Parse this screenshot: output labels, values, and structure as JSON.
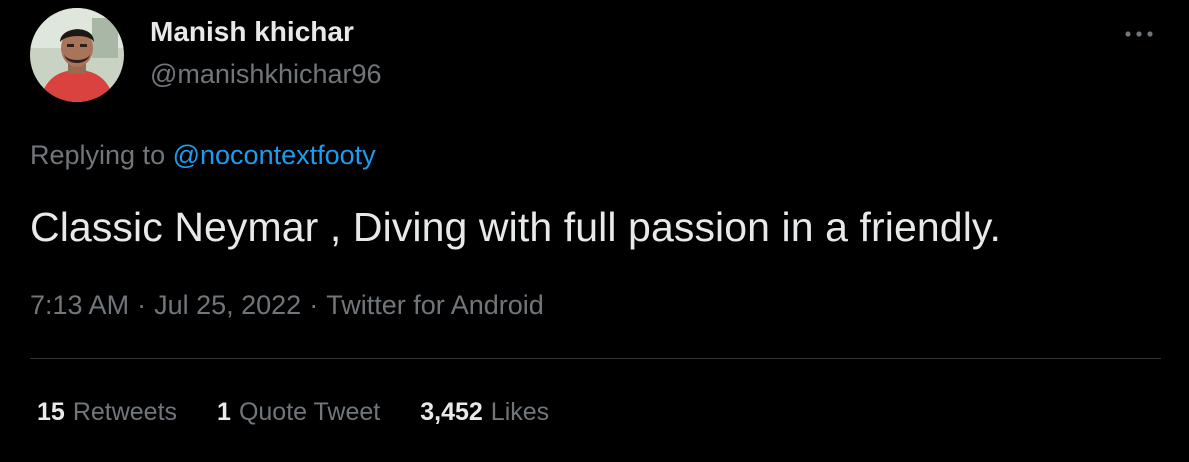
{
  "author": {
    "display_name": "Manish khichar",
    "handle": "@manishkhichar96",
    "avatar_icon": "user-avatar-photo"
  },
  "menu": {
    "icon": "more-options-icon"
  },
  "reply": {
    "prefix": "Replying to",
    "mention": "@nocontextfooty"
  },
  "tweet": {
    "text": "Classic Neymar , Diving with full passion in a friendly."
  },
  "meta": {
    "time": "7:13 AM",
    "separator": "·",
    "date": "Jul 25, 2022",
    "source": "Twitter for Android"
  },
  "stats": {
    "retweets": {
      "count": "15",
      "label": "Retweets"
    },
    "quotes": {
      "count": "1",
      "label": "Quote Tweet"
    },
    "likes": {
      "count": "3,452",
      "label": "Likes"
    }
  },
  "colors": {
    "background": "#000000",
    "primary_text": "#e7e9ea",
    "secondary_text": "#71767b",
    "link": "#1d9bf0",
    "divider": "#2f3336"
  }
}
